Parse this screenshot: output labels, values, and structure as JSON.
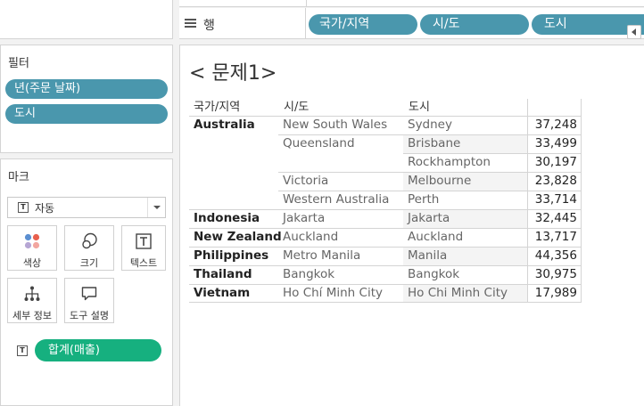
{
  "rows_shelf": {
    "label": "행",
    "pills": [
      "국가/지역",
      "시/도",
      "도시"
    ]
  },
  "filters": {
    "title": "필터",
    "pills": [
      "년(주문 날짜)",
      "도시"
    ]
  },
  "marks": {
    "title": "마크",
    "mark_type": "자동",
    "buttons": {
      "color": "색상",
      "size": "크기",
      "text": "텍스트",
      "detail": "세부 정보",
      "tooltip": "도구 설명"
    },
    "measure_pill": "합계(매출)"
  },
  "sheet": {
    "title": "< 문제1>"
  },
  "table": {
    "headers": [
      "국가/지역",
      "시/도",
      "도시"
    ],
    "countries": [
      "Australia",
      "Indonesia",
      "New Zealand",
      "Philippines",
      "Thailand",
      "Vietnam"
    ],
    "states": [
      "New South Wales",
      "Queensland",
      "Victoria",
      "Western Australia",
      "Jakarta",
      "Auckland",
      "Metro Manila",
      "Bangkok",
      "Ho Chí Minh City"
    ],
    "cities": [
      "Sydney",
      "Brisbane",
      "Rockhampton",
      "Melbourne",
      "Perth",
      "Jakarta",
      "Auckland",
      "Manila",
      "Bangkok",
      "Ho Chi Minh City"
    ],
    "values": [
      "37,248",
      "33,499",
      "30,197",
      "23,828",
      "33,714",
      "32,445",
      "13,717",
      "44,356",
      "30,975",
      "17,989"
    ]
  },
  "colors": {
    "dimension_pill": "#4a97ad",
    "measure_pill": "#16b07f"
  }
}
